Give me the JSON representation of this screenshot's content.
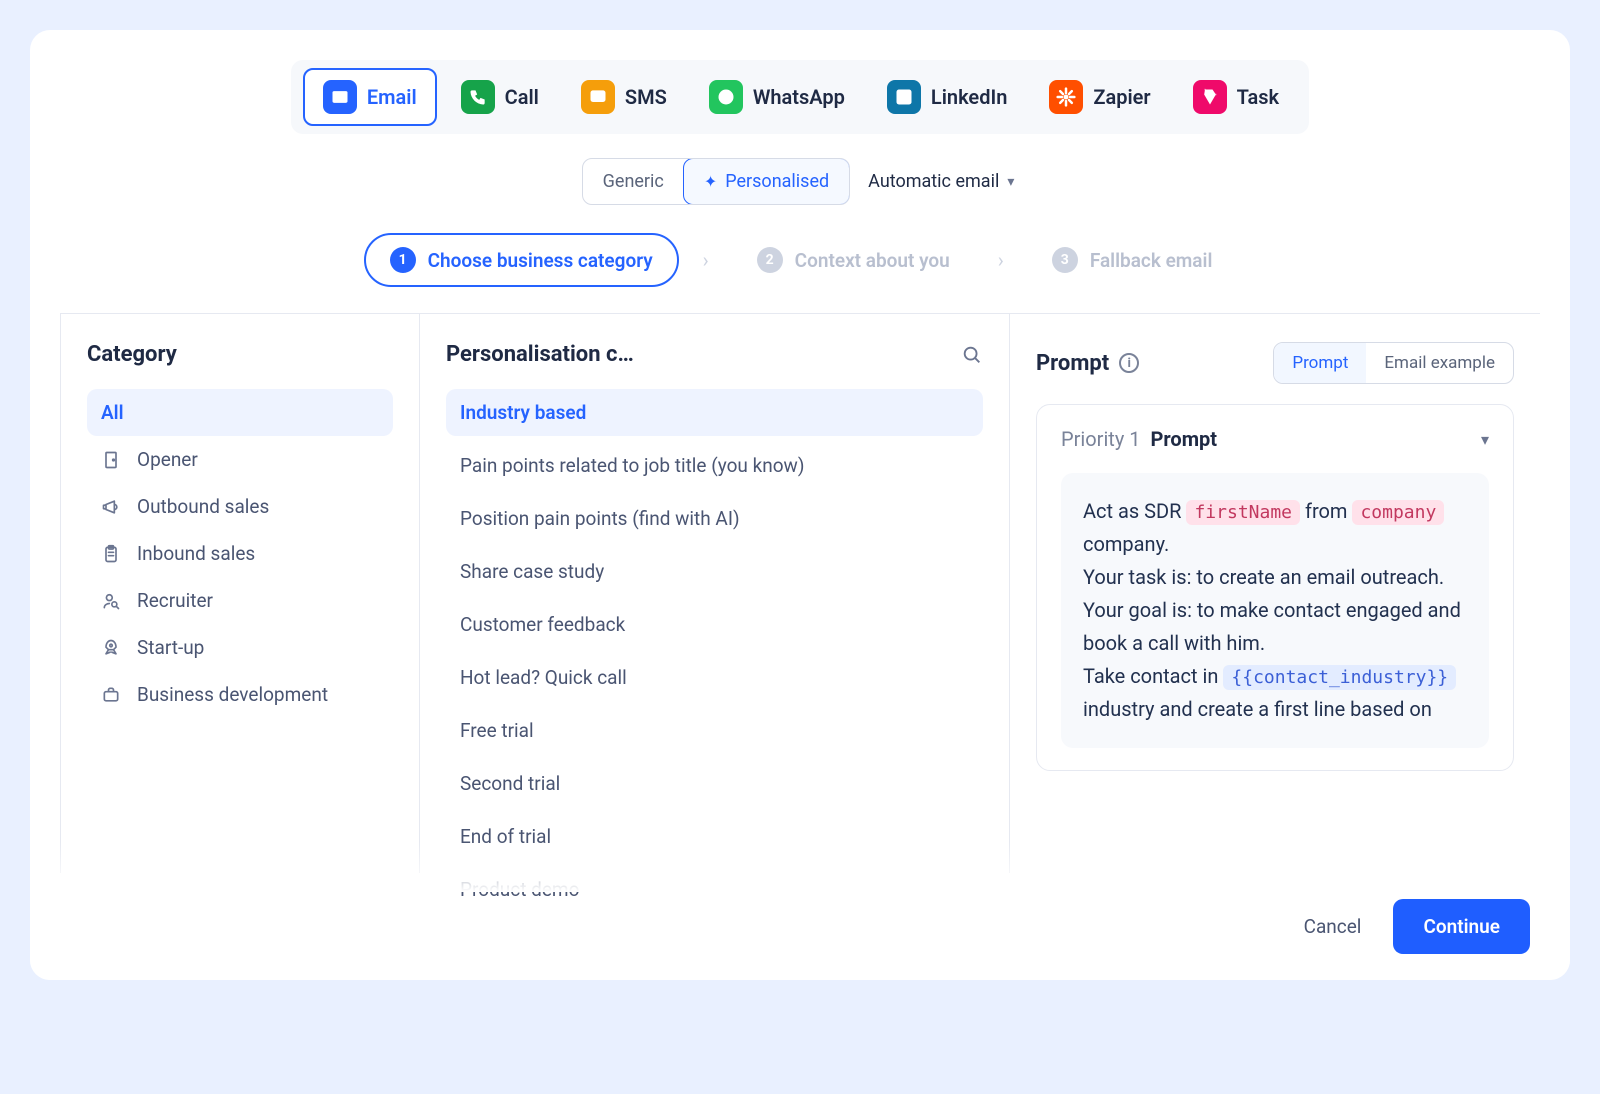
{
  "channels": [
    {
      "label": "Email",
      "color": "#2563ff",
      "active": true,
      "name": "channel-email"
    },
    {
      "label": "Call",
      "color": "#16a34a",
      "active": false,
      "name": "channel-call"
    },
    {
      "label": "SMS",
      "color": "#f59e0b",
      "active": false,
      "name": "channel-sms"
    },
    {
      "label": "WhatsApp",
      "color": "#22c55e",
      "active": false,
      "name": "channel-whatsapp"
    },
    {
      "label": "LinkedIn",
      "color": "#0e76a8",
      "active": false,
      "name": "channel-linkedin"
    },
    {
      "label": "Zapier",
      "color": "#ff4f00",
      "active": false,
      "name": "channel-zapier"
    },
    {
      "label": "Task",
      "color": "#ef0a6a",
      "active": false,
      "name": "channel-task"
    }
  ],
  "mode": {
    "generic": "Generic",
    "personalised": "Personalised",
    "dropdown": "Automatic email"
  },
  "steps": [
    {
      "n": "1",
      "label": "Choose business category",
      "active": true
    },
    {
      "n": "2",
      "label": "Context about you",
      "active": false
    },
    {
      "n": "3",
      "label": "Fallback email",
      "active": false
    }
  ],
  "categoryTitle": "Category",
  "categories": [
    {
      "label": "All",
      "active": true,
      "icon": "none"
    },
    {
      "label": "Opener",
      "active": false,
      "icon": "door"
    },
    {
      "label": "Outbound sales",
      "active": false,
      "icon": "megaphone"
    },
    {
      "label": "Inbound sales",
      "active": false,
      "icon": "clipboard"
    },
    {
      "label": "Recruiter",
      "active": false,
      "icon": "person-search"
    },
    {
      "label": "Start-up",
      "active": false,
      "icon": "rocket"
    },
    {
      "label": "Business development",
      "active": false,
      "icon": "briefcase"
    }
  ],
  "pcTitle": "Personalisation c…",
  "pc": [
    {
      "label": "Industry based",
      "active": true
    },
    {
      "label": "Pain points related to job title (you know)",
      "active": false
    },
    {
      "label": "Position pain points (find with AI)",
      "active": false
    },
    {
      "label": "Share case study",
      "active": false
    },
    {
      "label": "Customer feedback",
      "active": false
    },
    {
      "label": "Hot lead? Quick call",
      "active": false
    },
    {
      "label": "Free trial",
      "active": false
    },
    {
      "label": "Second trial",
      "active": false
    },
    {
      "label": "End of trial",
      "active": false
    },
    {
      "label": "Product demo",
      "active": false
    }
  ],
  "promptTitle": "Prompt",
  "promptTabs": {
    "a": "Prompt",
    "b": "Email example"
  },
  "promptBox": {
    "priority": "Priority 1",
    "title": "Prompt",
    "text1": "Act as SDR ",
    "tok1": "firstName",
    "text2": " from ",
    "tok2": "company",
    "text3": " company.",
    "line2": "Your task is: to create an email outreach.",
    "line3": "Your goal is: to make contact engaged and book a call with him.",
    "line4a": "Take contact in ",
    "tok3": "{{contact_industry}}",
    "line4b": " industry and create a first line based on"
  },
  "footer": {
    "cancel": "Cancel",
    "continue": "Continue"
  }
}
